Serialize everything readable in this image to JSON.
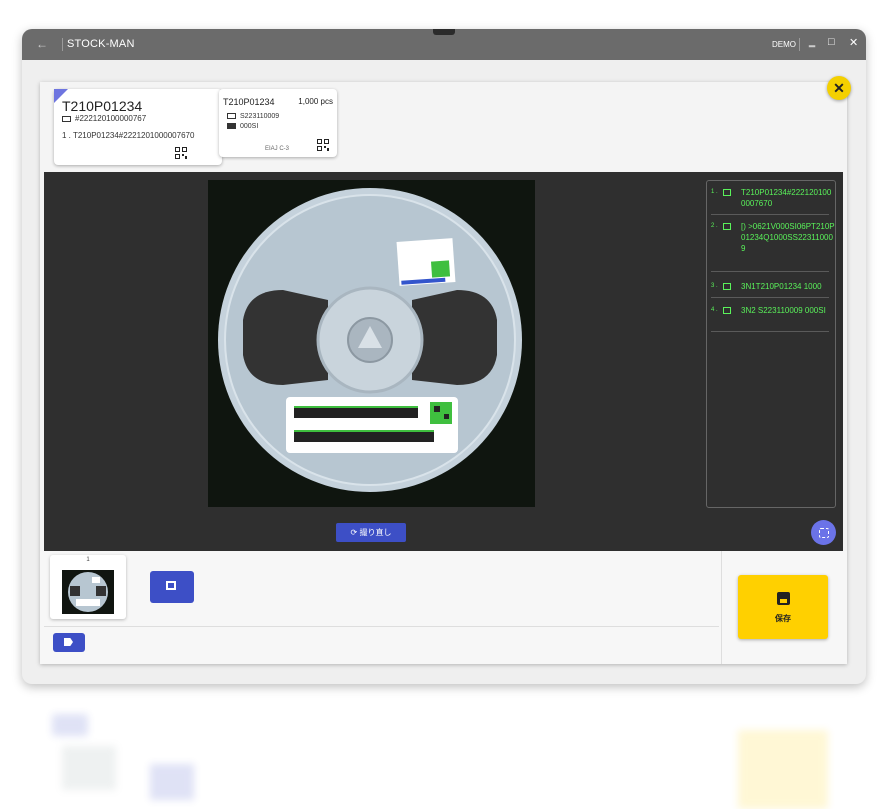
{
  "app": {
    "title": "STOCK-MAN",
    "mode_label": "DEMO",
    "back_glyph": "←",
    "min_glyph": "‗",
    "max_glyph": "□",
    "close_glyph": "✕"
  },
  "cards": [
    {
      "title": "T210P01234",
      "subtitle": "#222120100000767",
      "code_line": "1 . T210P01234#2221201000007670",
      "icons": [
        "barcode-icon",
        "qr-code-icon"
      ]
    },
    {
      "title": "T210P01234",
      "quantity": "1,000 pcs",
      "line1": "S223110009",
      "line2": "000SI",
      "footer": "EIAJ C-3",
      "icons": [
        "barcode-icon",
        "package-icon",
        "qr-code-icon"
      ]
    }
  ],
  "results": [
    {
      "index": "1 .",
      "icon": "qr-code-icon",
      "text": "T210P01234#2221201000007670"
    },
    {
      "index": "2 .",
      "icon": "qr-code-icon",
      "text": "[) >0621V000SI06PT210P01234Q1000SS223110009"
    },
    {
      "index": "3 .",
      "icon": "barcode-icon",
      "text": "3N1T210P01234 1000"
    },
    {
      "index": "4 .",
      "icon": "barcode-icon",
      "text": "3N2 S223110009 000SI"
    }
  ],
  "viewer": {
    "retake_label": "撮り直し"
  },
  "thumbnails": [
    {
      "number": "1"
    }
  ],
  "save_label": "保存",
  "colors": {
    "accent": "#3d4fc6",
    "highlight": "#ffd000",
    "result_text": "#5af25a",
    "titlebar": "#6b6b6b"
  }
}
